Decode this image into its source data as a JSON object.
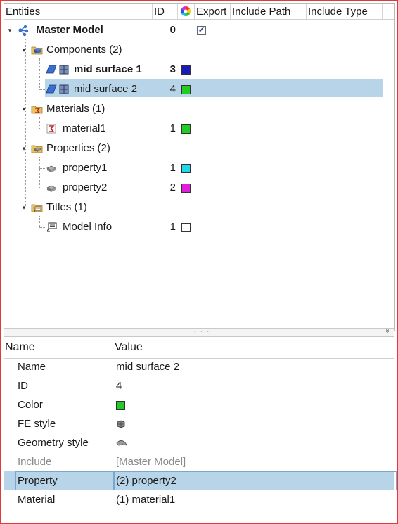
{
  "columns": {
    "entities": "Entities",
    "id": "ID",
    "export": "Export",
    "include_path": "Include Path",
    "include_type": "Include Type"
  },
  "tree": {
    "master": {
      "label": "Master Model",
      "id": "0",
      "export_checked": "✔"
    },
    "components": {
      "label": "Components (2)"
    },
    "mid1": {
      "label": "mid surface 1",
      "id": "3",
      "color": "#1a1ab8"
    },
    "mid2": {
      "label": "mid surface 2",
      "id": "4",
      "color": "#22cc22"
    },
    "materials": {
      "label": "Materials (1)"
    },
    "material1": {
      "label": "material1",
      "id": "1",
      "color": "#22cc22"
    },
    "properties": {
      "label": "Properties (2)"
    },
    "property1": {
      "label": "property1",
      "id": "1",
      "color": "#22d8e8"
    },
    "property2": {
      "label": "property2",
      "id": "2",
      "color": "#e020d8"
    },
    "titles": {
      "label": "Titles (1)"
    },
    "modelinfo": {
      "label": "Model Info",
      "id": "1",
      "color": "#ffffff"
    }
  },
  "props": {
    "header_name": "Name",
    "header_value": "Value",
    "rows": [
      {
        "name": "Name",
        "value": "mid surface 2"
      },
      {
        "name": "ID",
        "value": "4"
      },
      {
        "name": "Color",
        "value": ""
      },
      {
        "name": "FE style",
        "value": ""
      },
      {
        "name": "Geometry style",
        "value": ""
      },
      {
        "name": "Include",
        "value": "[Master Model]"
      },
      {
        "name": "Property",
        "value": "(2) property2"
      },
      {
        "name": "Material",
        "value": "(1) material1"
      }
    ],
    "color_swatch": "#22cc22"
  },
  "splitter": {
    "dots": "· · ·",
    "chevron": "»"
  }
}
